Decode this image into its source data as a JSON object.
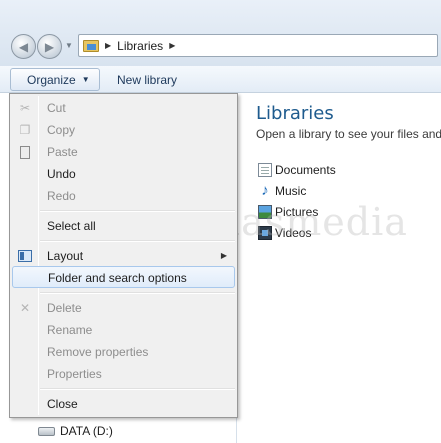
{
  "address": {
    "crumbs": [
      "Libraries"
    ]
  },
  "toolbar": {
    "organize_label": "Organize",
    "new_library_label": "New library"
  },
  "content": {
    "title": "Libraries",
    "subtitle": "Open a library to see your files and",
    "libraries": [
      {
        "label": "Documents",
        "icon": "documents-icon"
      },
      {
        "label": "Music",
        "icon": "music-icon"
      },
      {
        "label": "Pictures",
        "icon": "pictures-icon"
      },
      {
        "label": "Videos",
        "icon": "videos-icon"
      }
    ]
  },
  "menu": {
    "items": [
      {
        "label": "Cut",
        "enabled": false,
        "icon": "scissors-icon"
      },
      {
        "label": "Copy",
        "enabled": false,
        "icon": "copy-icon"
      },
      {
        "label": "Paste",
        "enabled": false,
        "icon": "paste-icon"
      },
      {
        "label": "Undo",
        "enabled": true
      },
      {
        "label": "Redo",
        "enabled": false
      },
      {
        "label": "Select all",
        "enabled": true
      },
      {
        "label": "Layout",
        "enabled": true,
        "icon": "layout-icon",
        "submenu": true
      },
      {
        "label": "Folder and search options",
        "enabled": true,
        "highlighted": true
      },
      {
        "label": "Delete",
        "enabled": false,
        "icon": "delete-icon"
      },
      {
        "label": "Rename",
        "enabled": false
      },
      {
        "label": "Remove properties",
        "enabled": false
      },
      {
        "label": "Properties",
        "enabled": false
      },
      {
        "label": "Close",
        "enabled": true
      }
    ]
  },
  "navpane": {
    "drive_label": "DATA (D:)"
  },
  "watermark": "Termasmedia",
  "colors": {
    "title": "#1e5b8e",
    "highlight_border": "#a8c8ec",
    "disabled_text": "#8d8d8d"
  }
}
